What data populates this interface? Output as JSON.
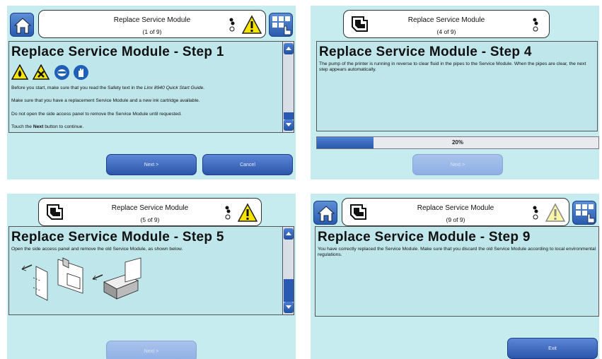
{
  "colors": {
    "panel_bg": "#c6ecef",
    "button_blue": "#2c56aa",
    "warning_yellow": "#f5e400"
  },
  "panel1": {
    "title": "Replace Service Module",
    "counter": "(1 of 9)",
    "heading": "Replace Service Module - Step 1",
    "line1_pre": "Before you start, make sure that you read the Safety text in the ",
    "line1_em": "Linx 8940 Quick Start Guide.",
    "line2": "Make sure that you have a replacement Service Module and a new ink cartridge available.",
    "line3": "Do not open the side access panel to remove the Service Module until requested.",
    "line4_pre": "Touch the ",
    "line4_bold": "Next",
    "line4_post": " button to continue.",
    "next_label": "Next >",
    "cancel_label": "Cancel"
  },
  "panel2": {
    "title": "Replace Service Module",
    "counter": "(4 of 9)",
    "heading": "Replace Service Module - Step 4",
    "body": "The pump of the printer is running in reverse to clear fluid in the pipes to the Service Module. When the pipes are clear, the next step appears automatically.",
    "progress_label": "20%",
    "progress_value": 0.2,
    "next_label": "Next >"
  },
  "panel3": {
    "title": "Replace Service Module",
    "counter": "(5 of 9)",
    "heading": "Replace Service Module - Step 5",
    "body": "Open the side access panel and remove the old Service Module, as shown below.",
    "next_label": "Next >"
  },
  "panel4": {
    "title": "Replace Service Module",
    "counter": "(9 of 9)",
    "heading": "Replace Service Module - Step 9",
    "body": "You have correctly replaced the Service Module. Make sure that you discard the old Service Module according to local environmental regulations.",
    "exit_label": "Exit"
  }
}
